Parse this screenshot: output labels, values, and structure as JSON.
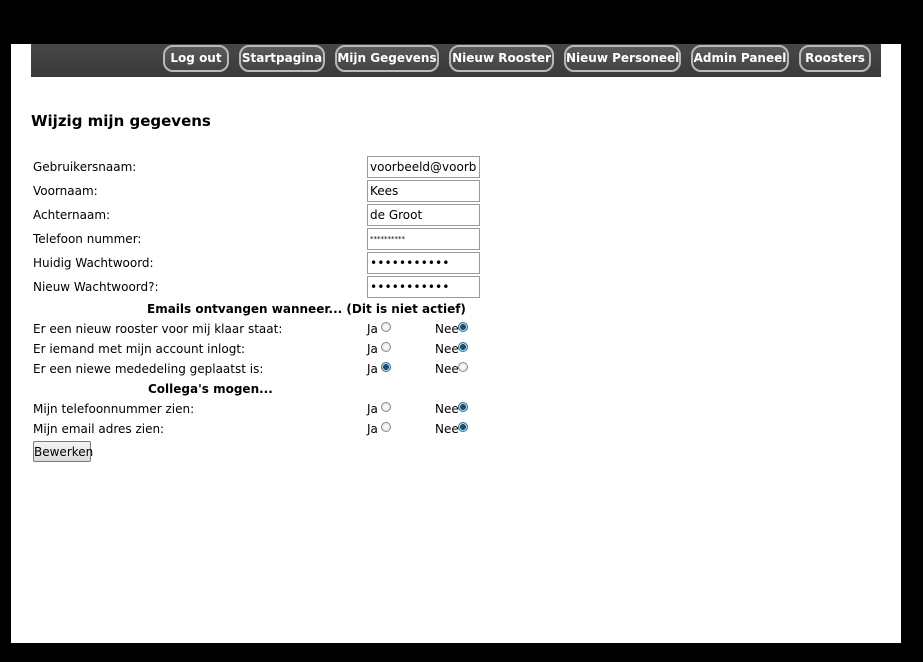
{
  "nav": {
    "logout": "Log out",
    "start": "Startpagina",
    "mijn": "Mijn Gegevens",
    "rooster": "Nieuw Rooster",
    "personeel": "Nieuw Personeel",
    "admin": "Admin Paneel",
    "roosters": "Roosters"
  },
  "title": "Wijzig mijn gegevens",
  "fields": {
    "username": {
      "label": "Gebruikersnaam:",
      "value": "voorbeeld@voorbee"
    },
    "firstname": {
      "label": "Voornaam:",
      "value": "Kees"
    },
    "lastname": {
      "label": "Achternaam:",
      "value": "de Groot"
    },
    "phone": {
      "label": "Telefoon nummer:",
      "value": "**********"
    },
    "current_pw": {
      "label": "Huidig Wachtwoord:",
      "value": "•••••••••••"
    },
    "new_pw": {
      "label": "Nieuw Wachtwoord?:",
      "value": "•••••••••••"
    }
  },
  "emails_header": "Emails ontvangen wanneer... (Dit is niet actief)",
  "colleagues_header": "Collega's mogen...",
  "options": {
    "yes": "Ja",
    "no": "Nee"
  },
  "questions": {
    "q1": {
      "label": "Er een nieuw rooster voor mij klaar staat:",
      "selected": "Nee"
    },
    "q2": {
      "label": "Er iemand met mijn account inlogt:",
      "selected": "Nee"
    },
    "q3": {
      "label": "Er een niewe mededeling geplaatst is:",
      "selected": "Ja"
    },
    "q4": {
      "label": "Mijn telefoonnummer zien:",
      "selected": "Nee"
    },
    "q5": {
      "label": "Mijn email adres zien:",
      "selected": "Nee"
    }
  },
  "submit": "Bewerken"
}
